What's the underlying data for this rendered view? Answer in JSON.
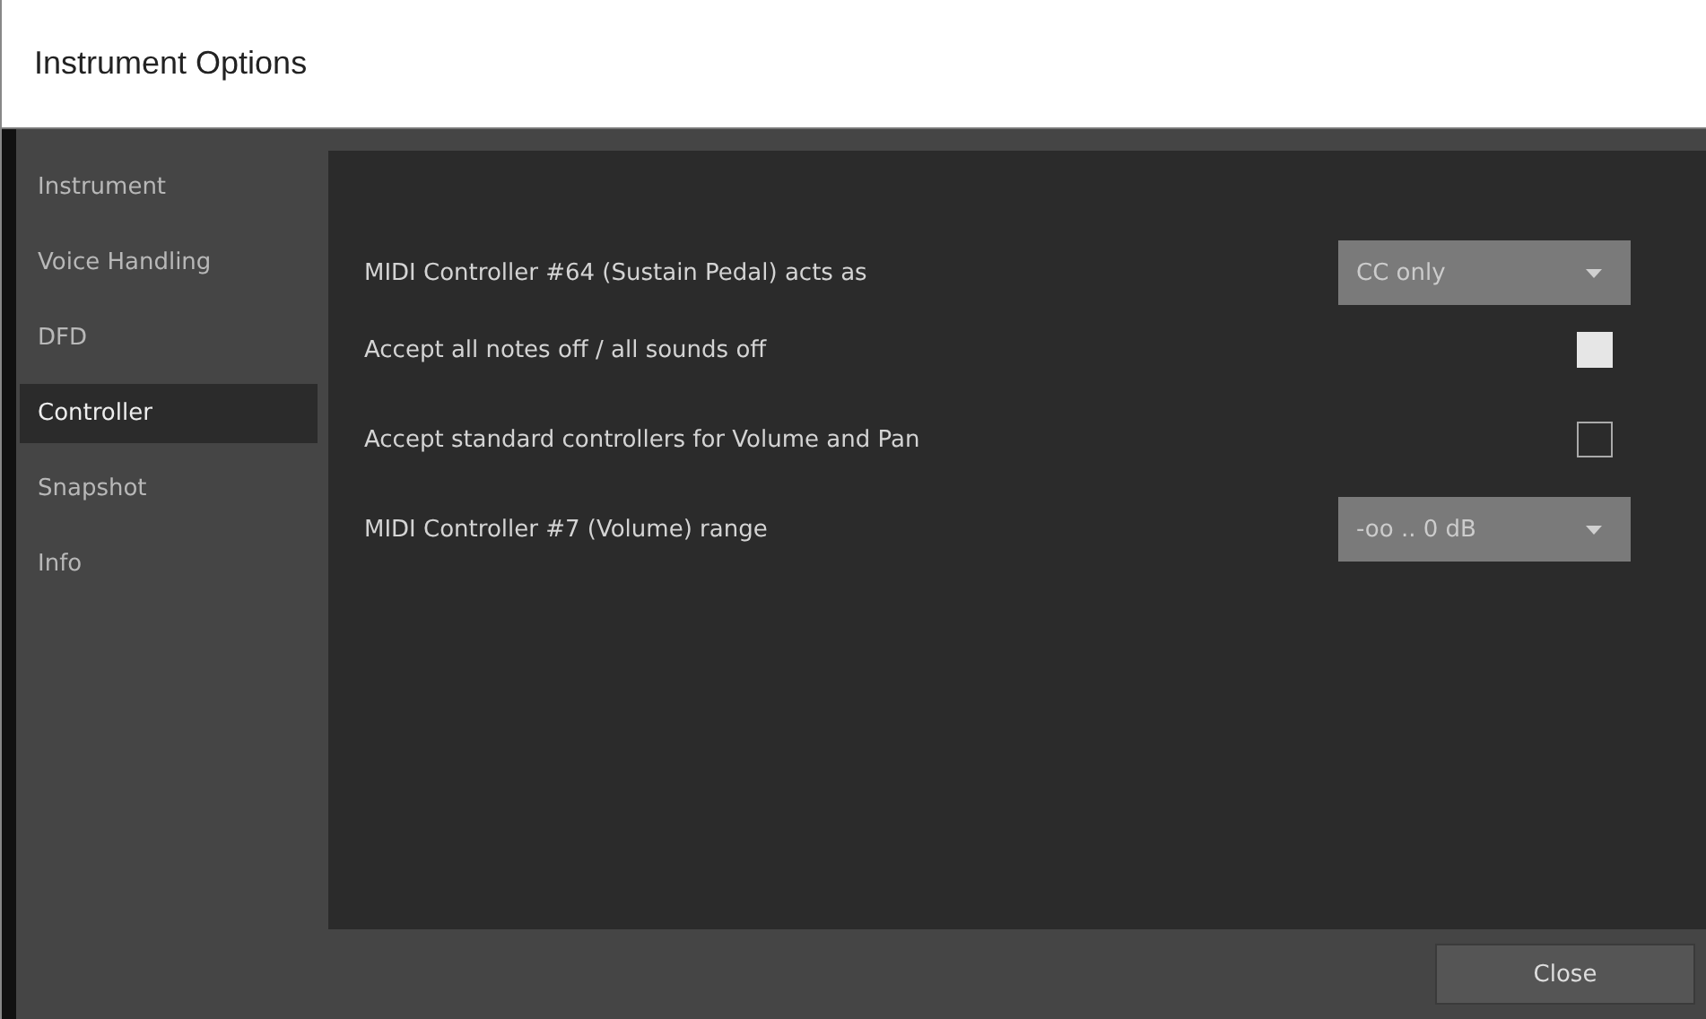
{
  "window": {
    "title": "Instrument Options"
  },
  "sidebar": {
    "items": [
      {
        "label": "Instrument",
        "selected": false
      },
      {
        "label": "Voice Handling",
        "selected": false
      },
      {
        "label": "DFD",
        "selected": false
      },
      {
        "label": "Controller",
        "selected": true
      },
      {
        "label": "Snapshot",
        "selected": false
      },
      {
        "label": "Info",
        "selected": false
      }
    ]
  },
  "options": [
    {
      "kind": "dropdown",
      "label": "MIDI Controller #64 (Sustain Pedal) acts as",
      "value": "CC only"
    },
    {
      "kind": "checkbox",
      "label": "Accept all notes off / all sounds off",
      "checked": true
    },
    {
      "kind": "checkbox",
      "label": "Accept standard controllers for Volume and Pan",
      "checked": false
    },
    {
      "kind": "dropdown",
      "label": "MIDI Controller #7 (Volume) range",
      "value": "-oo .. 0 dB"
    }
  ],
  "buttons": [
    "Close"
  ]
}
